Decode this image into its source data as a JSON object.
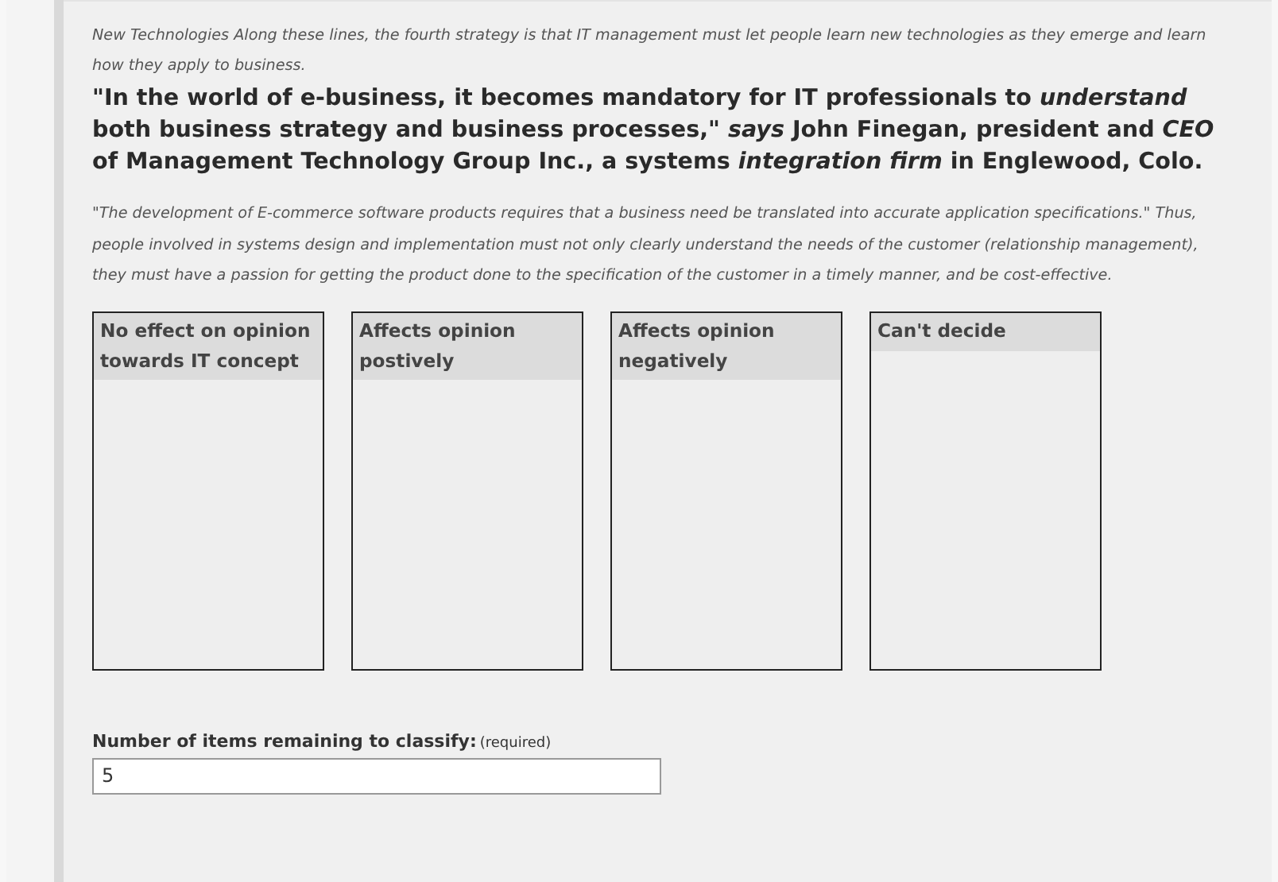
{
  "intro": "New Technologies Along these lines, the fourth strategy is that IT management must let people learn new technologies as they emerge and learn how they apply to business.",
  "quote": "\"In the world of e-business, it becomes mandatory for IT professionals to *understand* both business strategy and business processes,\" *says* John Finegan, president and *CEO* of Management Technology Group Inc., a systems *integration firm* in Englewood, Colo.",
  "paragraph": "\"The development of E-commerce software products requires that a business need be translated into accurate application specifications.\" Thus, people involved in systems design and implementation must not only clearly understand the needs of the customer (relationship management), they must have a passion for getting the product done to the specification of the customer in a timely manner, and be cost-effective.",
  "categories": [
    {
      "label": "No effect on opinion towards IT concept"
    },
    {
      "label": "Affects opinion postively"
    },
    {
      "label": "Affects opinion negatively"
    },
    {
      "label": "Can't decide"
    }
  ],
  "field": {
    "label": "Number of items remaining to classify:",
    "note": "(required)",
    "value": "5"
  }
}
